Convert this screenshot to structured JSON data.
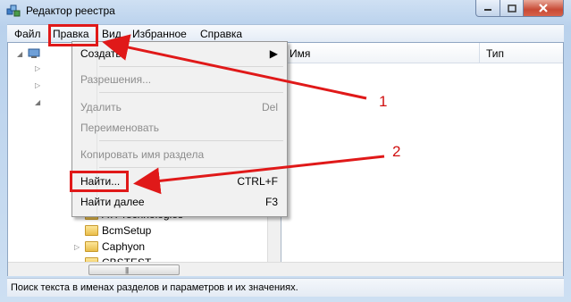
{
  "window": {
    "title": "Редактор реестра",
    "controls": {
      "minimize": "minimize",
      "maximize": "maximize",
      "close": "close"
    }
  },
  "menubar": {
    "items": [
      "Файл",
      "Правка",
      "Вид",
      "Избранное",
      "Справка"
    ]
  },
  "columns": {
    "name": "Имя",
    "type": "Тип"
  },
  "tree": {
    "visible_items": [
      "ATI Technologies",
      "BcmSetup",
      "Caphyon",
      "CBSTEST"
    ]
  },
  "edit_menu": {
    "items": [
      {
        "label": "Создать",
        "accel": "",
        "submenu": true,
        "disabled": false
      },
      {
        "label": "Разрешения...",
        "accel": "",
        "disabled": true
      },
      {
        "label": "Удалить",
        "accel": "Del",
        "disabled": true
      },
      {
        "label": "Переименовать",
        "accel": "",
        "disabled": true
      },
      {
        "label": "Копировать имя раздела",
        "accel": "",
        "disabled": true
      },
      {
        "label": "Найти...",
        "accel": "CTRL+F",
        "disabled": false
      },
      {
        "label": "Найти далее",
        "accel": "F3",
        "disabled": false
      }
    ]
  },
  "statusbar": {
    "text": "Поиск текста в именах разделов и параметров и их значениях."
  },
  "annotations": {
    "labels": [
      "1",
      "2"
    ],
    "color": "#d01010"
  }
}
